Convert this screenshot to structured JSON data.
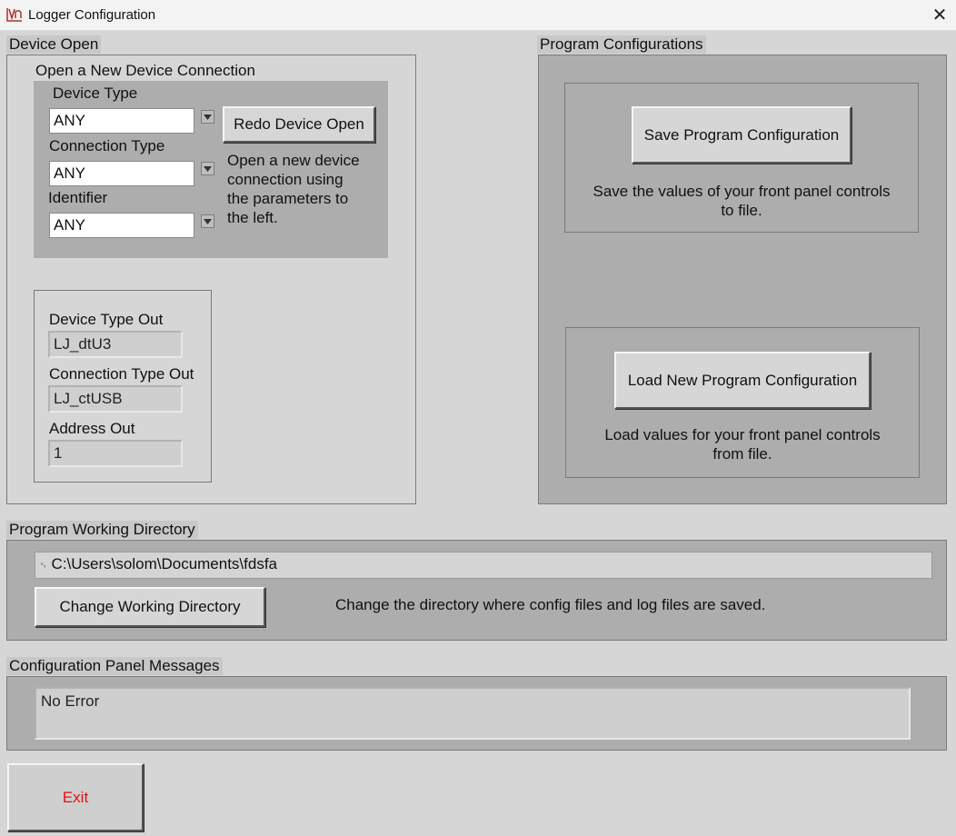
{
  "window": {
    "title": "Logger Configuration",
    "close_glyph": "✕"
  },
  "device_open": {
    "section_title": "Device Open",
    "group_title": "Open a New Device Connection",
    "device_type_label": "Device Type",
    "device_type_value": "ANY",
    "connection_type_label": "Connection Type",
    "connection_type_value": "ANY",
    "identifier_label": "Identifier",
    "identifier_value": "ANY",
    "redo_button": "Redo Device Open",
    "redo_desc": [
      "Open a new device",
      "connection using",
      "the parameters to",
      "the left."
    ],
    "device_type_out_label": "Device Type Out",
    "device_type_out_value": "LJ_dtU3",
    "connection_type_out_label": "Connection Type Out",
    "connection_type_out_value": "LJ_ctUSB",
    "address_out_label": "Address Out",
    "address_out_value": "1"
  },
  "program_configurations": {
    "section_title": "Program Configurations",
    "save_button": "Save Program Configuration",
    "save_desc": [
      "Save the values of your front panel controls",
      "to file."
    ],
    "load_button": "Load New Program Configuration",
    "load_desc": [
      "Load values for your front panel controls",
      "from file."
    ]
  },
  "working_directory": {
    "section_title": "Program Working Directory",
    "path_prefix": "␋",
    "path_value": "C:\\Users\\solom\\Documents\\fdsfa",
    "change_button": "Change Working Directory",
    "change_desc": "Change the directory where config files and log files are saved."
  },
  "messages": {
    "section_title": "Configuration Panel Messages",
    "value": "No Error"
  },
  "exit_button": "Exit",
  "colors": {
    "panel_bg": "#d6d6d6",
    "dark_panel": "#adadad",
    "exit_text": "#e01010"
  }
}
